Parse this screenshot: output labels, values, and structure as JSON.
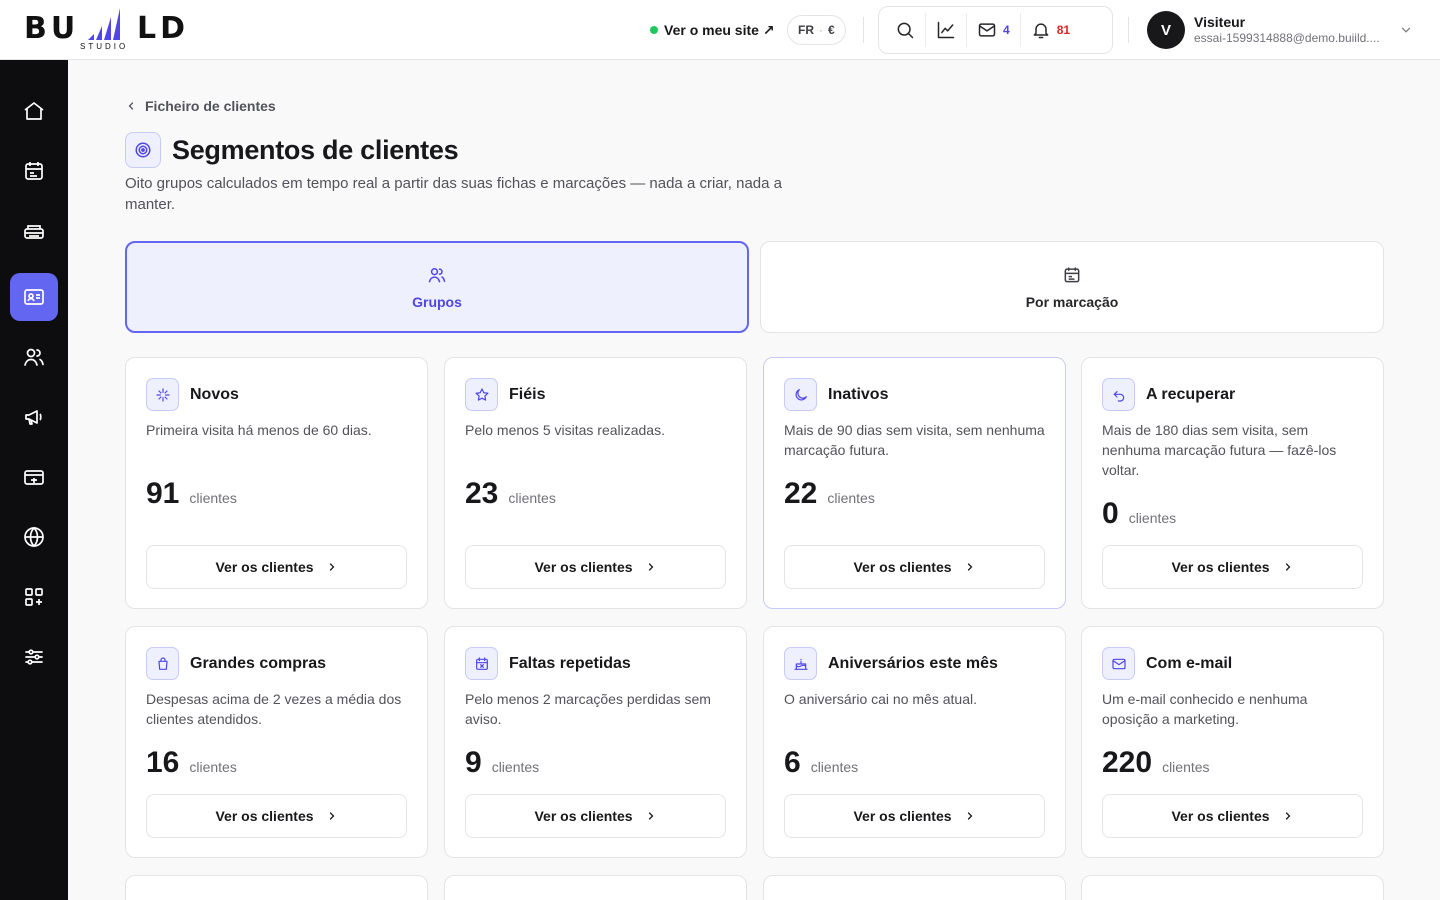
{
  "brand": {
    "name": "BUILD",
    "sub": "STUDIO"
  },
  "header": {
    "site_link": "Ver o meu site ↗",
    "lang": "FR",
    "currency": "€",
    "messages_count": "4",
    "notifications_count": "81",
    "user": {
      "initial": "V",
      "name": "Visiteur",
      "email": "essai-1599314888@demo.buiild...."
    }
  },
  "colors": {
    "accent": "#6366f1",
    "accent_bg": "#eef0fe",
    "sidebar_bg": "#0d0d10",
    "online": "#22c55e",
    "alert": "#dc2626"
  },
  "sidebar": {
    "items": [
      {
        "icon": "home-icon"
      },
      {
        "icon": "calendar-icon"
      },
      {
        "icon": "cash-register-icon"
      },
      {
        "icon": "client-card-icon",
        "active": true
      },
      {
        "icon": "team-icon"
      },
      {
        "icon": "megaphone-icon"
      },
      {
        "icon": "wallet-icon"
      },
      {
        "icon": "globe-icon"
      },
      {
        "icon": "apps-icon"
      },
      {
        "icon": "sliders-icon"
      }
    ]
  },
  "page": {
    "back_label": "Ficheiro de clientes",
    "title": "Segmentos de clientes",
    "subtitle": "Oito grupos calculados em tempo real a partir das suas fichas e marcações — nada a criar, nada a manter."
  },
  "tabs": [
    {
      "label": "Grupos",
      "icon": "users-icon",
      "active": true
    },
    {
      "label": "Por marcação",
      "icon": "calendar-icon",
      "active": false
    }
  ],
  "segments": [
    {
      "icon": "sparkle-icon",
      "title": "Novos",
      "desc": "Primeira visita há menos de 60 dias.",
      "count": "91",
      "unit": "clientes",
      "button": "Ver os clientes"
    },
    {
      "icon": "star-icon",
      "title": "Fiéis",
      "desc": "Pelo menos 5 visitas realizadas.",
      "count": "23",
      "unit": "clientes",
      "button": "Ver os clientes"
    },
    {
      "icon": "moon-icon",
      "title": "Inativos",
      "desc": "Mais de 90 dias sem visita, sem nenhuma marcação futura.",
      "count": "22",
      "unit": "clientes",
      "button": "Ver os clientes"
    },
    {
      "icon": "undo-icon",
      "title": "A recuperar",
      "desc": "Mais de 180 dias sem visita, sem nenhuma marcação futura — fazê-los voltar.",
      "count": "0",
      "unit": "clientes",
      "button": "Ver os clientes"
    },
    {
      "icon": "shopping-bag-icon",
      "title": "Grandes compras",
      "desc": "Despesas acima de 2 vezes a média dos clientes atendidos.",
      "count": "16",
      "unit": "clientes",
      "button": "Ver os clientes"
    },
    {
      "icon": "calendar-x-icon",
      "title": "Faltas repetidas",
      "desc": "Pelo menos 2 marcações perdidas sem aviso.",
      "count": "9",
      "unit": "clientes",
      "button": "Ver os clientes"
    },
    {
      "icon": "cake-icon",
      "title": "Aniversários este mês",
      "desc": "O aniversário cai no mês atual.",
      "count": "6",
      "unit": "clientes",
      "button": "Ver os clientes"
    },
    {
      "icon": "mail-icon",
      "title": "Com e-mail",
      "desc": "Um e-mail conhecido e nenhuma oposição a marketing.",
      "count": "220",
      "unit": "clientes",
      "button": "Ver os clientes"
    }
  ]
}
